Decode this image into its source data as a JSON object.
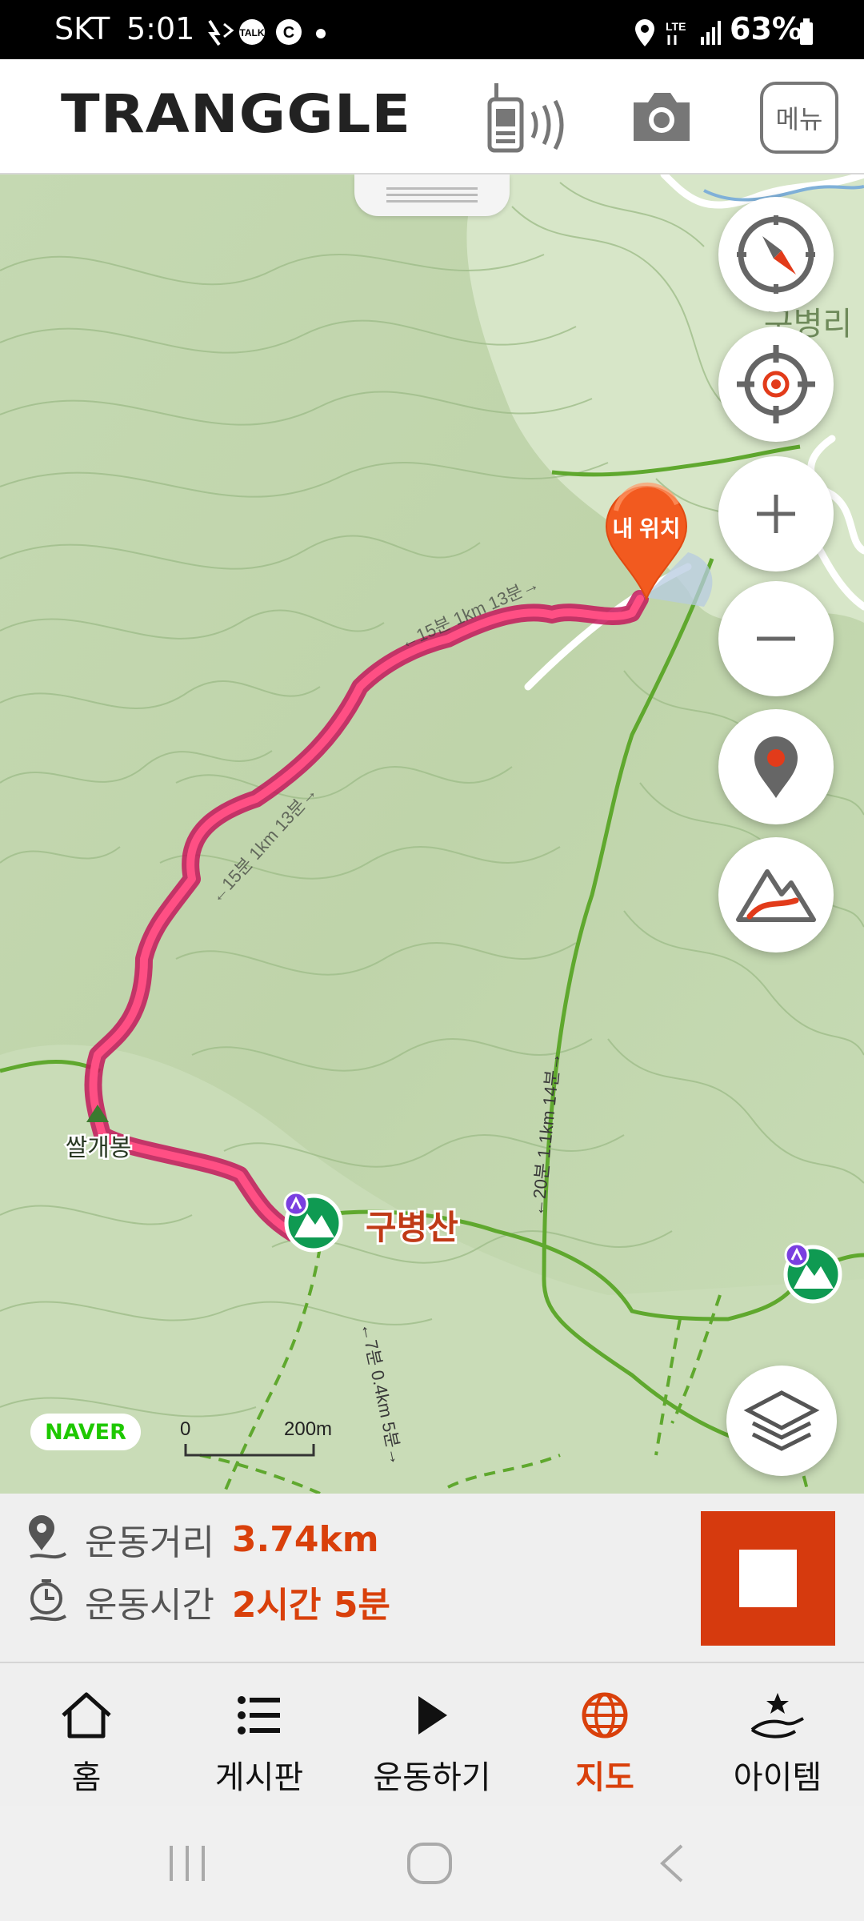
{
  "status_bar": {
    "carrier": "SKT",
    "time": "5:01",
    "network": "LTE",
    "battery": "63%",
    "icons": [
      "wifi-calling-icon",
      "kakaotalk-icon",
      "c-icon",
      "dot-icon",
      "location-icon",
      "signal-icon",
      "battery-icon"
    ]
  },
  "header": {
    "logo": "TRANGGLE",
    "menu_label": "메뉴",
    "icons": [
      "walkie-talkie-icon",
      "camera-icon"
    ]
  },
  "map": {
    "my_location_label": "내 위치",
    "place_labels": {
      "peak_main": "구병산",
      "peak_secondary": "쌀개봉",
      "village": "구병리"
    },
    "trail_labels": {
      "trail_east": "←20분 1.1km 14분→",
      "trail_south": "←7분 0.4km 5분→",
      "route_seg1": "←15분 1km 13분→",
      "route_seg2": "←15분 1km 13분→"
    },
    "provider": "NAVER",
    "scale": {
      "start": "0",
      "end": "200m"
    },
    "controls": [
      "compass-button",
      "locate-button",
      "zoom-in-button",
      "zoom-out-button",
      "place-marker-button",
      "elevation-button",
      "layers-button"
    ],
    "colors": {
      "route": "#ff2e6a",
      "trail": "#5fa82e",
      "marker": "#f25a1f",
      "peak_badge": "#0f9a52"
    }
  },
  "info": {
    "distance_label": "운동거리",
    "distance_value": "3.74km",
    "time_label": "운동시간",
    "time_value": "2시간 5분",
    "accent": "#d9400b"
  },
  "bottom_nav": {
    "items": [
      {
        "label": "홈",
        "icon": "home-icon",
        "active": false
      },
      {
        "label": "게시판",
        "icon": "list-icon",
        "active": false
      },
      {
        "label": "운동하기",
        "icon": "play-icon",
        "active": false
      },
      {
        "label": "지도",
        "icon": "globe-icon",
        "active": true
      },
      {
        "label": "아이템",
        "icon": "item-hand-star-icon",
        "active": false
      }
    ]
  },
  "system_nav": [
    "recent-apps-icon",
    "home-circle-icon",
    "back-icon"
  ]
}
